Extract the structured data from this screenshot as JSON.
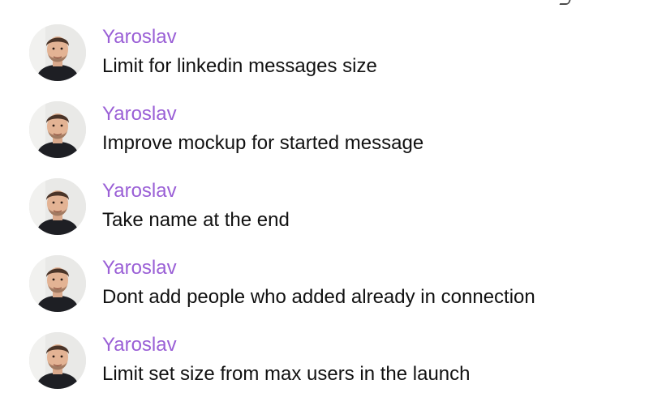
{
  "messages": [
    {
      "author": "Yaroslav",
      "text": "Limit for linkedin messages size"
    },
    {
      "author": "Yaroslav",
      "text": "Improve mockup for started message"
    },
    {
      "author": "Yaroslav",
      "text": "Take name at the end"
    },
    {
      "author": "Yaroslav",
      "text": "Dont add people who added already in connection"
    },
    {
      "author": "Yaroslav",
      "text": "Limit set size from max users in the launch"
    }
  ],
  "colors": {
    "author_name": "#9a5fd6",
    "message_text": "#111111",
    "background": "#ffffff"
  },
  "icons": {
    "avatar": "user-photo-avatar"
  }
}
